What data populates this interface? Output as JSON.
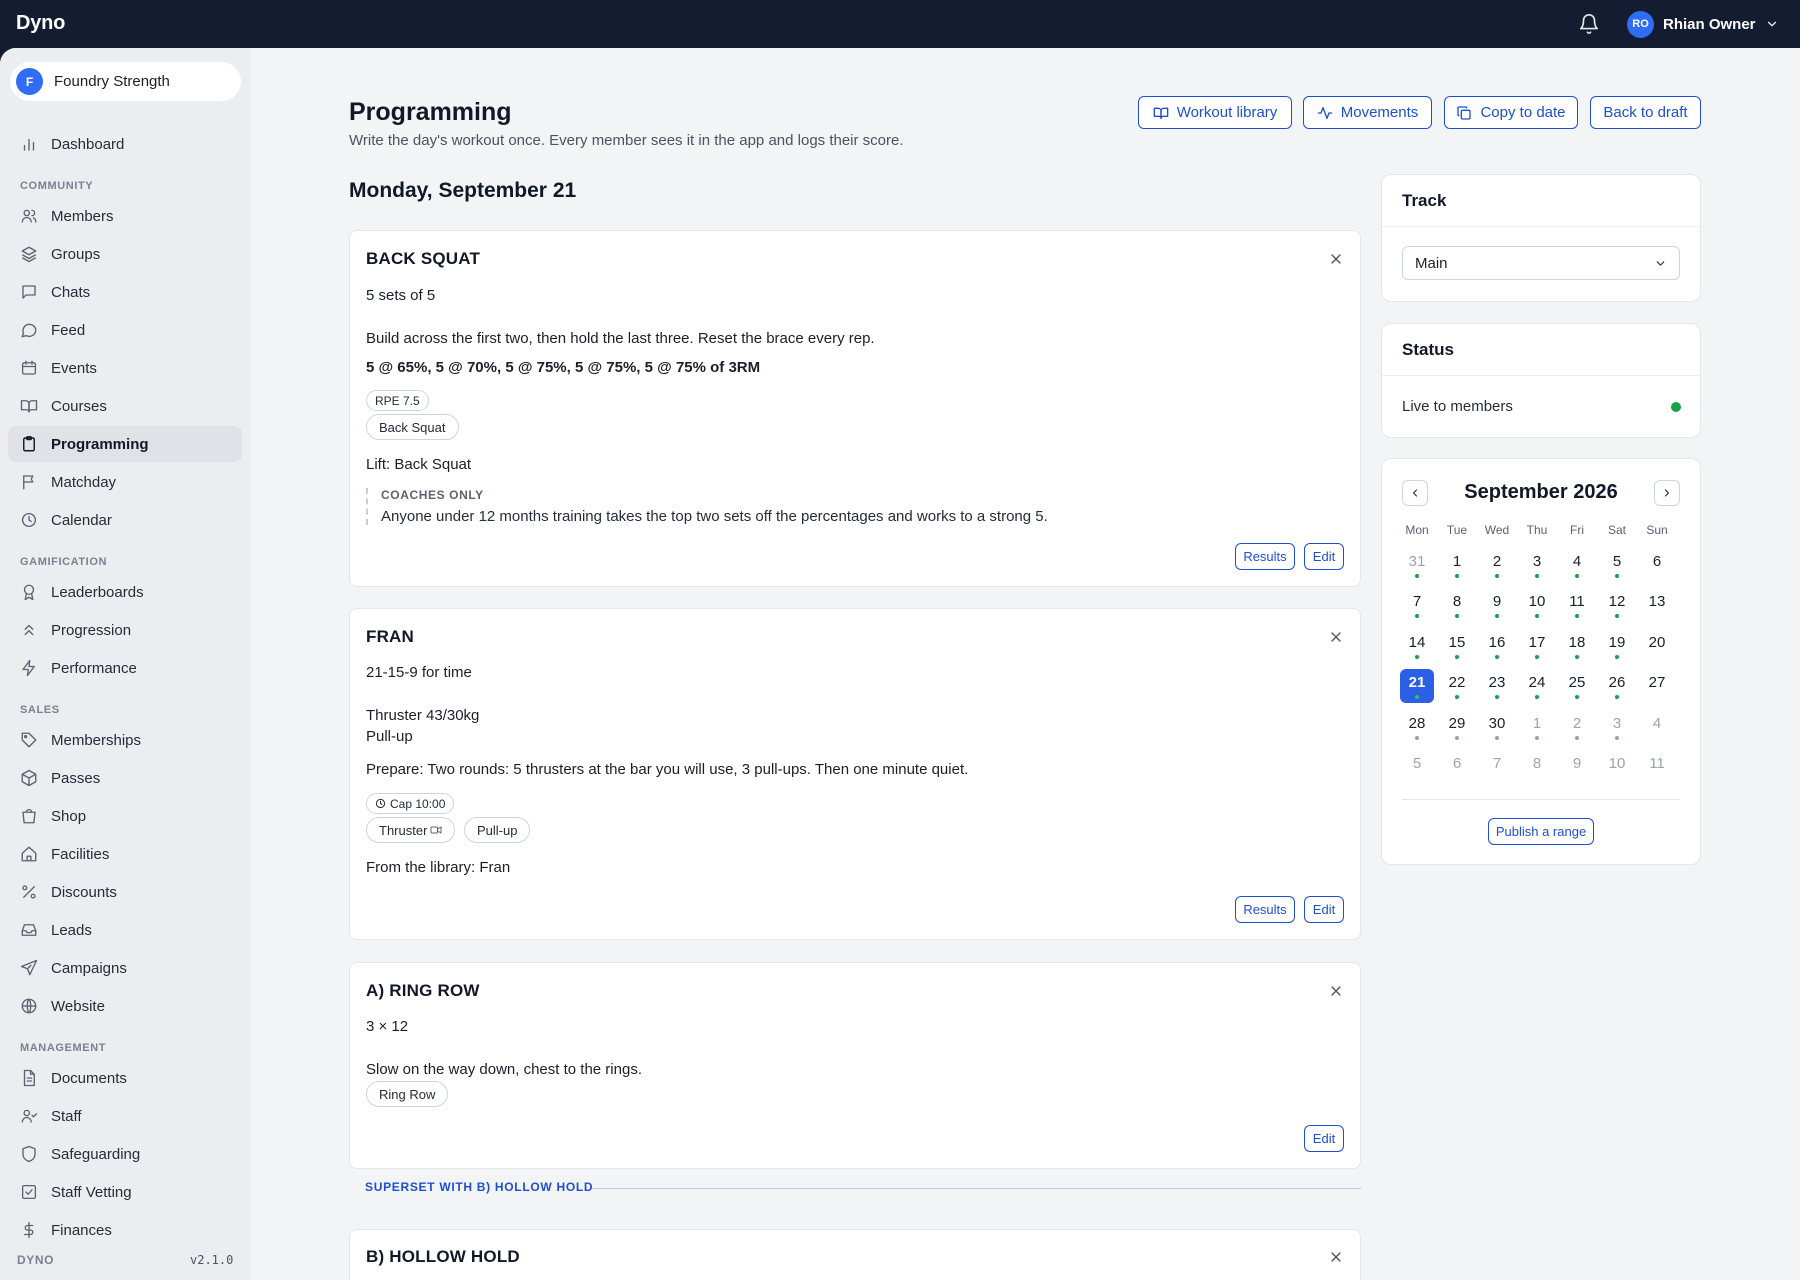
{
  "app": {
    "brand": "Dyno"
  },
  "user": {
    "initials": "RO",
    "name": "Rhian Owner"
  },
  "org": {
    "initial": "F",
    "name": "Foundry Strength"
  },
  "sidebar": {
    "dashboard": "Dashboard",
    "sections": {
      "community": "COMMUNITY",
      "gamification": "GAMIFICATION",
      "sales": "SALES",
      "management": "MANAGEMENT"
    },
    "community": [
      "Members",
      "Groups",
      "Chats",
      "Feed",
      "Events",
      "Courses",
      "Programming",
      "Matchday",
      "Calendar"
    ],
    "gamification": [
      "Leaderboards",
      "Progression",
      "Performance"
    ],
    "sales": [
      "Memberships",
      "Passes",
      "Shop",
      "Facilities",
      "Discounts",
      "Leads",
      "Campaigns",
      "Website"
    ],
    "management": [
      "Documents",
      "Staff",
      "Safeguarding",
      "Staff Vetting",
      "Finances"
    ],
    "footer_label": "DYNO",
    "version": "v2.1.0"
  },
  "page": {
    "title": "Programming",
    "subtitle": "Write the day's workout once. Every member sees it in the app and logs their score.",
    "actions": {
      "workout_library": "Workout library",
      "movements": "Movements",
      "copy_to_date": "Copy to date",
      "back_to_draft": "Back to draft"
    },
    "date": "Monday, September 21"
  },
  "workouts": [
    {
      "title": "BACK SQUAT",
      "scheme": "5 sets of 5",
      "description": "Build across the first two, then hold the last three. Reset the brace every rep.",
      "prescription": "5 @ 65%, 5 @ 70%, 5 @ 75%, 5 @ 75%, 5 @ 75% of 3RM",
      "chip": "RPE 7.5",
      "movements": [
        "Back Squat"
      ],
      "source": "Lift: Back Squat",
      "coach_heading": "COACHES ONLY",
      "coach_note": "Anyone under 12 months training takes the top two sets off the percentages and works to a strong 5.",
      "results": "Results",
      "edit": "Edit"
    },
    {
      "title": "FRAN",
      "scheme": "21-15-9 for time",
      "lines": [
        "Thruster 43/30kg",
        "Pull-up"
      ],
      "prepare": "Prepare: Two rounds: 5 thrusters at the bar you will use, 3 pull-ups. Then one minute quiet.",
      "chip": "Cap 10:00",
      "movements": [
        "Thruster",
        "Pull-up"
      ],
      "source": "From the library: Fran",
      "results": "Results",
      "edit": "Edit"
    },
    {
      "title": "A) RING ROW",
      "scheme": "3 × 12",
      "description": "Slow on the way down, chest to the rings.",
      "movements": [
        "Ring Row"
      ],
      "edit": "Edit"
    },
    {
      "title": "B) HOLLOW HOLD"
    }
  ],
  "superset_label": "SUPERSET WITH B) HOLLOW HOLD",
  "track": {
    "heading": "Track",
    "value": "Main"
  },
  "status": {
    "heading": "Status",
    "text": "Live to members",
    "color": "#16a34a"
  },
  "calendar": {
    "month": "September 2026",
    "weekdays": [
      "Mon",
      "Tue",
      "Wed",
      "Thu",
      "Fri",
      "Sat",
      "Sun"
    ],
    "selected": 21,
    "weeks": [
      [
        {
          "d": "31",
          "m": true,
          "dot": "green"
        },
        {
          "d": "1",
          "dot": "green"
        },
        {
          "d": "2",
          "dot": "green"
        },
        {
          "d": "3",
          "dot": "green"
        },
        {
          "d": "4",
          "dot": "green"
        },
        {
          "d": "5",
          "dot": "green"
        },
        {
          "d": "6"
        }
      ],
      [
        {
          "d": "7",
          "dot": "green"
        },
        {
          "d": "8",
          "dot": "green"
        },
        {
          "d": "9",
          "dot": "green"
        },
        {
          "d": "10",
          "dot": "green"
        },
        {
          "d": "11",
          "dot": "green"
        },
        {
          "d": "12",
          "dot": "green"
        },
        {
          "d": "13"
        }
      ],
      [
        {
          "d": "14",
          "dot": "green"
        },
        {
          "d": "15",
          "dot": "green"
        },
        {
          "d": "16",
          "dot": "green"
        },
        {
          "d": "17",
          "dot": "green"
        },
        {
          "d": "18",
          "dot": "green"
        },
        {
          "d": "19",
          "dot": "green"
        },
        {
          "d": "20"
        }
      ],
      [
        {
          "d": "21",
          "dot": "green",
          "sel": true
        },
        {
          "d": "22",
          "dot": "green"
        },
        {
          "d": "23",
          "dot": "green"
        },
        {
          "d": "24",
          "dot": "green"
        },
        {
          "d": "25",
          "dot": "green"
        },
        {
          "d": "26",
          "dot": "green"
        },
        {
          "d": "27"
        }
      ],
      [
        {
          "d": "28",
          "dot": "grey"
        },
        {
          "d": "29",
          "dot": "grey"
        },
        {
          "d": "30",
          "dot": "grey"
        },
        {
          "d": "1",
          "m": true,
          "dot": "grey"
        },
        {
          "d": "2",
          "m": true,
          "dot": "grey"
        },
        {
          "d": "3",
          "m": true,
          "dot": "grey"
        },
        {
          "d": "4",
          "m": true
        }
      ],
      [
        {
          "d": "5",
          "m": true
        },
        {
          "d": "6",
          "m": true
        },
        {
          "d": "7",
          "m": true
        },
        {
          "d": "8",
          "m": true
        },
        {
          "d": "9",
          "m": true
        },
        {
          "d": "10",
          "m": true
        },
        {
          "d": "11",
          "m": true
        }
      ]
    ],
    "publish": "Publish a range"
  },
  "colors": {
    "accent": "#1f4fd1",
    "topbar": "#131c30",
    "selected_day": "#2b5fe6",
    "workout_dot": "#16a34a"
  }
}
